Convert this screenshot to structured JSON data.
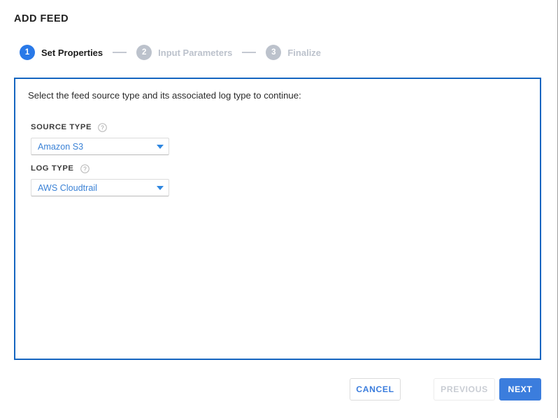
{
  "header": {
    "title": "ADD FEED"
  },
  "stepper": {
    "steps": [
      {
        "number": "1",
        "label": "Set Properties",
        "state": "active"
      },
      {
        "number": "2",
        "label": "Input Parameters",
        "state": "inactive"
      },
      {
        "number": "3",
        "label": "Finalize",
        "state": "inactive"
      }
    ]
  },
  "panel": {
    "intro": "Select the feed source type and its associated log type to continue:",
    "fields": [
      {
        "label": "SOURCE TYPE",
        "help_icon": "question-circle-icon",
        "value": "Amazon S3",
        "caret_icon": "chevron-down-icon"
      },
      {
        "label": "LOG TYPE",
        "help_icon": "question-circle-icon",
        "value": "AWS Cloudtrail",
        "caret_icon": "chevron-down-icon"
      }
    ]
  },
  "footer": {
    "cancel_label": "CANCEL",
    "previous_label": "PREVIOUS",
    "next_label": "NEXT"
  },
  "colors": {
    "accent_blue": "#2979e8",
    "panel_border": "#1565c0",
    "primary_button": "#3b7ddd",
    "inactive_gray": "#bcc2cc",
    "link_blue": "#3b82d6"
  }
}
